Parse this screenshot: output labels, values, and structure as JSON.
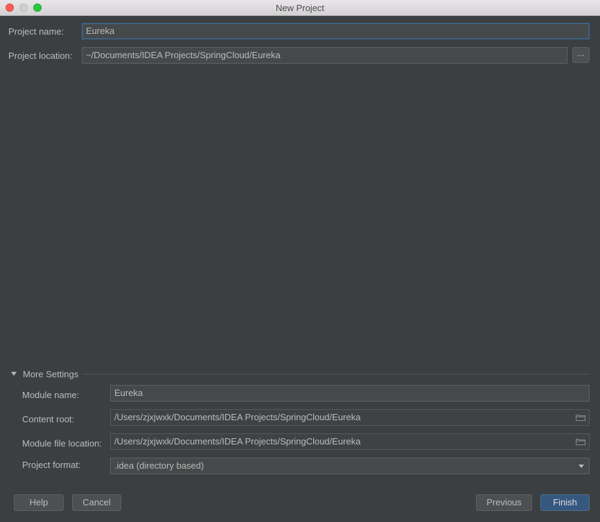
{
  "window": {
    "title": "New Project"
  },
  "project": {
    "name_label": "Project name:",
    "name_value": "Eureka",
    "location_label": "Project location:",
    "location_value": "~/Documents/IDEA Projects/SpringCloud/Eureka",
    "browse_label": "..."
  },
  "more_settings": {
    "header": "More Settings",
    "module_name_label": "Module name:",
    "module_name_value": "Eureka",
    "content_root_label": "Content root:",
    "content_root_value": "/Users/zjxjwxk/Documents/IDEA Projects/SpringCloud/Eureka",
    "module_file_label": "Module file location:",
    "module_file_value": "/Users/zjxjwxk/Documents/IDEA Projects/SpringCloud/Eureka",
    "project_format_label": "Project format:",
    "project_format_value": ".idea (directory based)"
  },
  "buttons": {
    "help": "Help",
    "cancel": "Cancel",
    "previous": "Previous",
    "finish": "Finish"
  },
  "icons": {
    "folder": "folder-icon",
    "dropdown": "chevron-down-icon",
    "collapse": "triangle-down-icon"
  },
  "colors": {
    "background": "#3c3f41",
    "field": "#45494a",
    "focus": "#3d6185",
    "primary_button": "#365880"
  }
}
